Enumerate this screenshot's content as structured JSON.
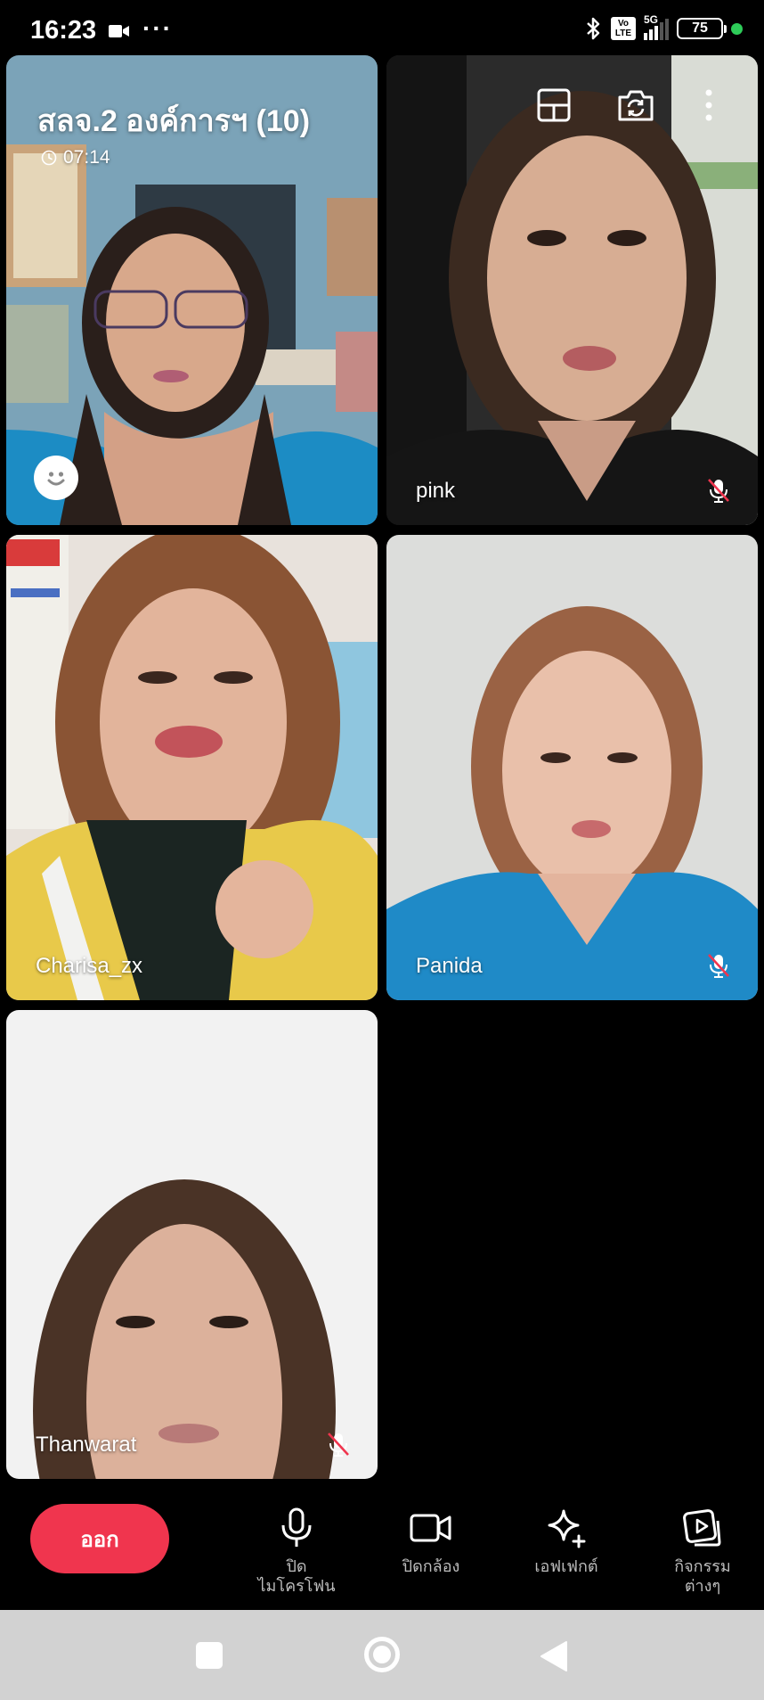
{
  "status_bar": {
    "time": "16:23",
    "more": "···",
    "network_badge": "Vo LTE",
    "network_type": "5G",
    "battery": "75"
  },
  "call": {
    "title": "สลจ.2 องค์การฯ (10)",
    "timer": "07:14"
  },
  "participants": [
    {
      "name": "",
      "muted": false,
      "is_self": true
    },
    {
      "name": "pink",
      "muted": true
    },
    {
      "name": "Charisa_zx",
      "muted": false
    },
    {
      "name": "Panida",
      "muted": true
    },
    {
      "name": "Thanwarat",
      "muted": true
    }
  ],
  "controls": {
    "leave": "ออก",
    "mic_line1": "ปิด",
    "mic_line2": "ไมโครโฟน",
    "camera": "ปิดกล้อง",
    "effects": "เอฟเฟกต์",
    "activities_line1": "กิจกรรม",
    "activities_line2": "ต่างๆ"
  },
  "colors": {
    "leave_button": "#f0354e",
    "background": "#000000",
    "nav_bar": "#d2d2d2"
  },
  "icons": [
    "video-camera-icon",
    "bluetooth-icon",
    "clock-icon",
    "emoji-icon",
    "layout-icon",
    "flip-camera-icon",
    "more-vertical-icon",
    "mic-muted-icon",
    "microphone-icon",
    "camera-icon",
    "sparkle-icon",
    "activities-icon"
  ]
}
